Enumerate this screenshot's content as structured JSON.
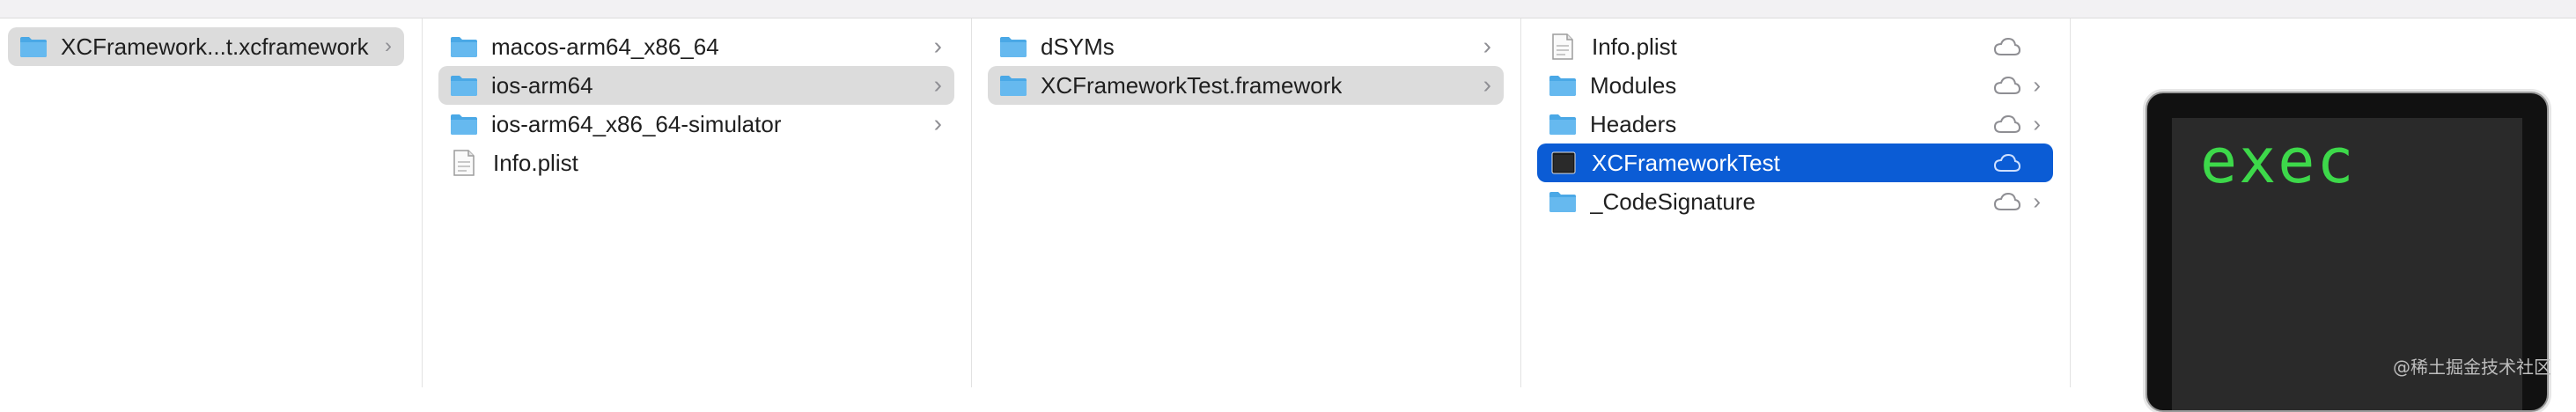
{
  "columns": [
    {
      "items": [
        {
          "label": "XCFramework...t.xcframework",
          "icon": "folder-icon",
          "selected": "gray",
          "chevron": true
        }
      ]
    },
    {
      "items": [
        {
          "label": "macos-arm64_x86_64",
          "icon": "folder-icon",
          "chevron": true
        },
        {
          "label": "ios-arm64",
          "icon": "folder-icon",
          "selected": "gray",
          "chevron": true
        },
        {
          "label": "ios-arm64_x86_64-simulator",
          "icon": "folder-icon",
          "chevron": true
        },
        {
          "label": "Info.plist",
          "icon": "plist-file-icon"
        }
      ]
    },
    {
      "items": [
        {
          "label": "dSYMs",
          "icon": "folder-icon",
          "chevron": true
        },
        {
          "label": "XCFrameworkTest.framework",
          "icon": "folder-icon",
          "selected": "gray",
          "chevron": true
        }
      ]
    },
    {
      "items": [
        {
          "label": "Info.plist",
          "icon": "plist-file-icon",
          "cloud": true
        },
        {
          "label": "Modules",
          "icon": "folder-icon",
          "cloud": true,
          "chevron": true
        },
        {
          "label": "Headers",
          "icon": "folder-icon",
          "cloud": true,
          "chevron": true
        },
        {
          "label": "XCFrameworkTest",
          "icon": "exec-icon",
          "cloud": true,
          "selected": "blue"
        },
        {
          "label": "_CodeSignature",
          "icon": "folder-icon",
          "cloud": true,
          "chevron": true
        }
      ]
    }
  ],
  "chevron_glyph": "›",
  "preview": {
    "terminal_text": "exec",
    "watermark": "@稀土掘金技术社区"
  },
  "colors": {
    "selection_blue": "#0b5cd5",
    "selection_gray": "#dcdcdc",
    "folder_blue": "#4aa8e6",
    "terminal_green": "#3dd84a"
  }
}
